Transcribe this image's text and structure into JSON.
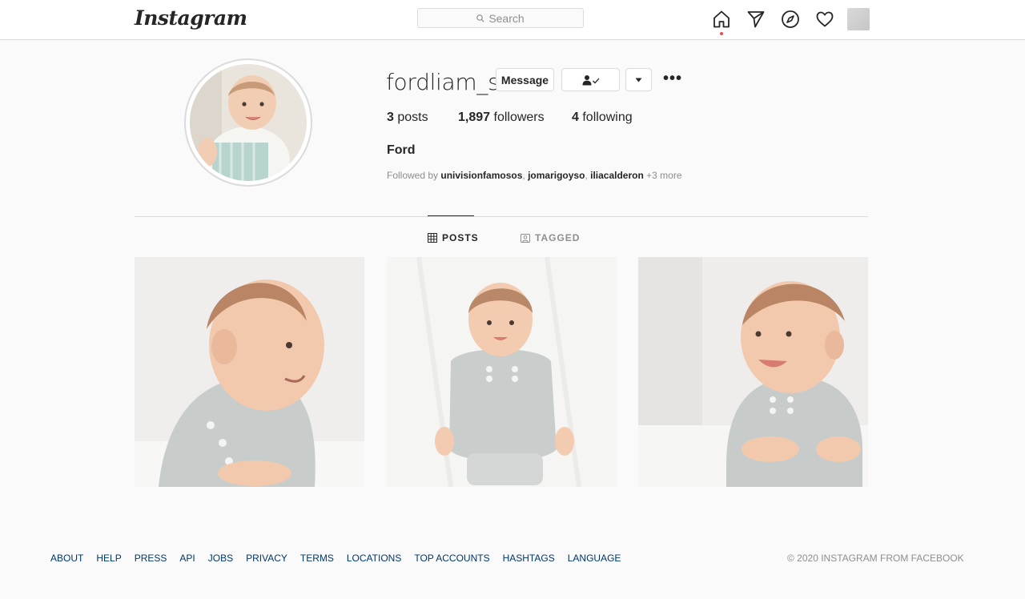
{
  "header": {
    "logo_text": "Instagram",
    "search_placeholder": "Search",
    "icons": [
      "home-icon",
      "direct-icon",
      "explore-icon",
      "activity-heart-icon"
    ]
  },
  "profile": {
    "username": "fordliam_s",
    "message_label": "Message",
    "posts_count": "3",
    "posts_label": "posts",
    "followers_count": "1,897",
    "followers_label": "followers",
    "following_count": "4",
    "following_label": "following",
    "full_name": "Ford",
    "followed_by_prefix": "Followed by",
    "followed_by_users": [
      "univisionfamosos",
      "jomarigoyso",
      "iliacalderon"
    ],
    "followed_by_more": "+3 more"
  },
  "tabs": {
    "posts": "POSTS",
    "tagged": "TAGGED"
  },
  "footer": {
    "links": [
      "ABOUT",
      "HELP",
      "PRESS",
      "API",
      "JOBS",
      "PRIVACY",
      "TERMS",
      "LOCATIONS",
      "TOP ACCOUNTS",
      "HASHTAGS",
      "LANGUAGE"
    ],
    "copyright": "© 2020 INSTAGRAM FROM FACEBOOK"
  },
  "colors": {
    "background": "#fafafa",
    "border": "#dbdbdb",
    "text": "#262626",
    "muted": "#8e8e8e",
    "link": "#00376b",
    "notification": "#ed4956"
  }
}
